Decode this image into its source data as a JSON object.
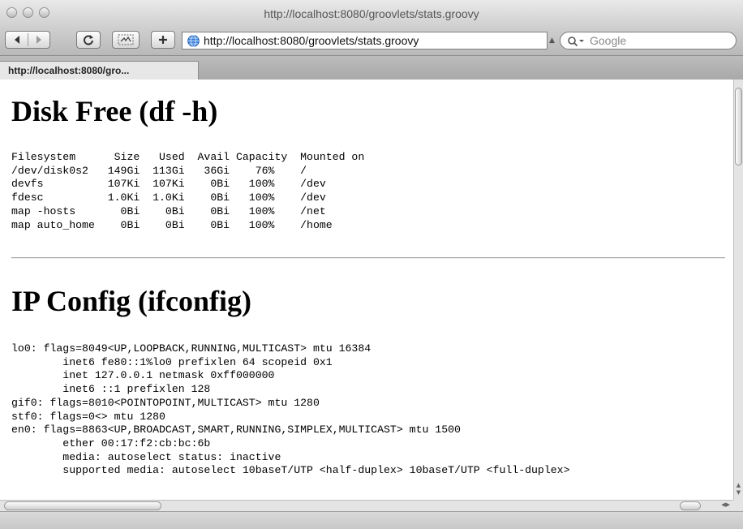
{
  "window": {
    "title": "http://localhost:8080/groovlets/stats.groovy"
  },
  "toolbar": {
    "url": "http://localhost:8080/groovlets/stats.groovy",
    "search_placeholder": "Google"
  },
  "tabs": [
    {
      "label": "http://localhost:8080/gro..."
    }
  ],
  "sections": {
    "disk": {
      "heading": "Disk Free (df -h)",
      "output": "Filesystem      Size   Used  Avail Capacity  Mounted on\n/dev/disk0s2   149Gi  113Gi   36Gi    76%    /\ndevfs          107Ki  107Ki    0Bi   100%    /dev\nfdesc          1.0Ki  1.0Ki    0Bi   100%    /dev\nmap -hosts       0Bi    0Bi    0Bi   100%    /net\nmap auto_home    0Bi    0Bi    0Bi   100%    /home"
    },
    "ip": {
      "heading": "IP Config (ifconfig)",
      "output": "lo0: flags=8049<UP,LOOPBACK,RUNNING,MULTICAST> mtu 16384\n        inet6 fe80::1%lo0 prefixlen 64 scopeid 0x1\n        inet 127.0.0.1 netmask 0xff000000\n        inet6 ::1 prefixlen 128\ngif0: flags=8010<POINTOPOINT,MULTICAST> mtu 1280\nstf0: flags=0<> mtu 1280\nen0: flags=8863<UP,BROADCAST,SMART,RUNNING,SIMPLEX,MULTICAST> mtu 1500\n        ether 00:17:f2:cb:bc:6b\n        media: autoselect status: inactive\n        supported media: autoselect 10baseT/UTP <half-duplex> 10baseT/UTP <full-duplex>"
    }
  },
  "icons": {
    "back": "back-arrow-icon",
    "forward": "forward-arrow-icon",
    "reload": "reload-icon",
    "snapback": "snapback-icon",
    "add_bookmark": "plus-icon",
    "site": "globe-icon",
    "search": "magnifier-icon"
  }
}
